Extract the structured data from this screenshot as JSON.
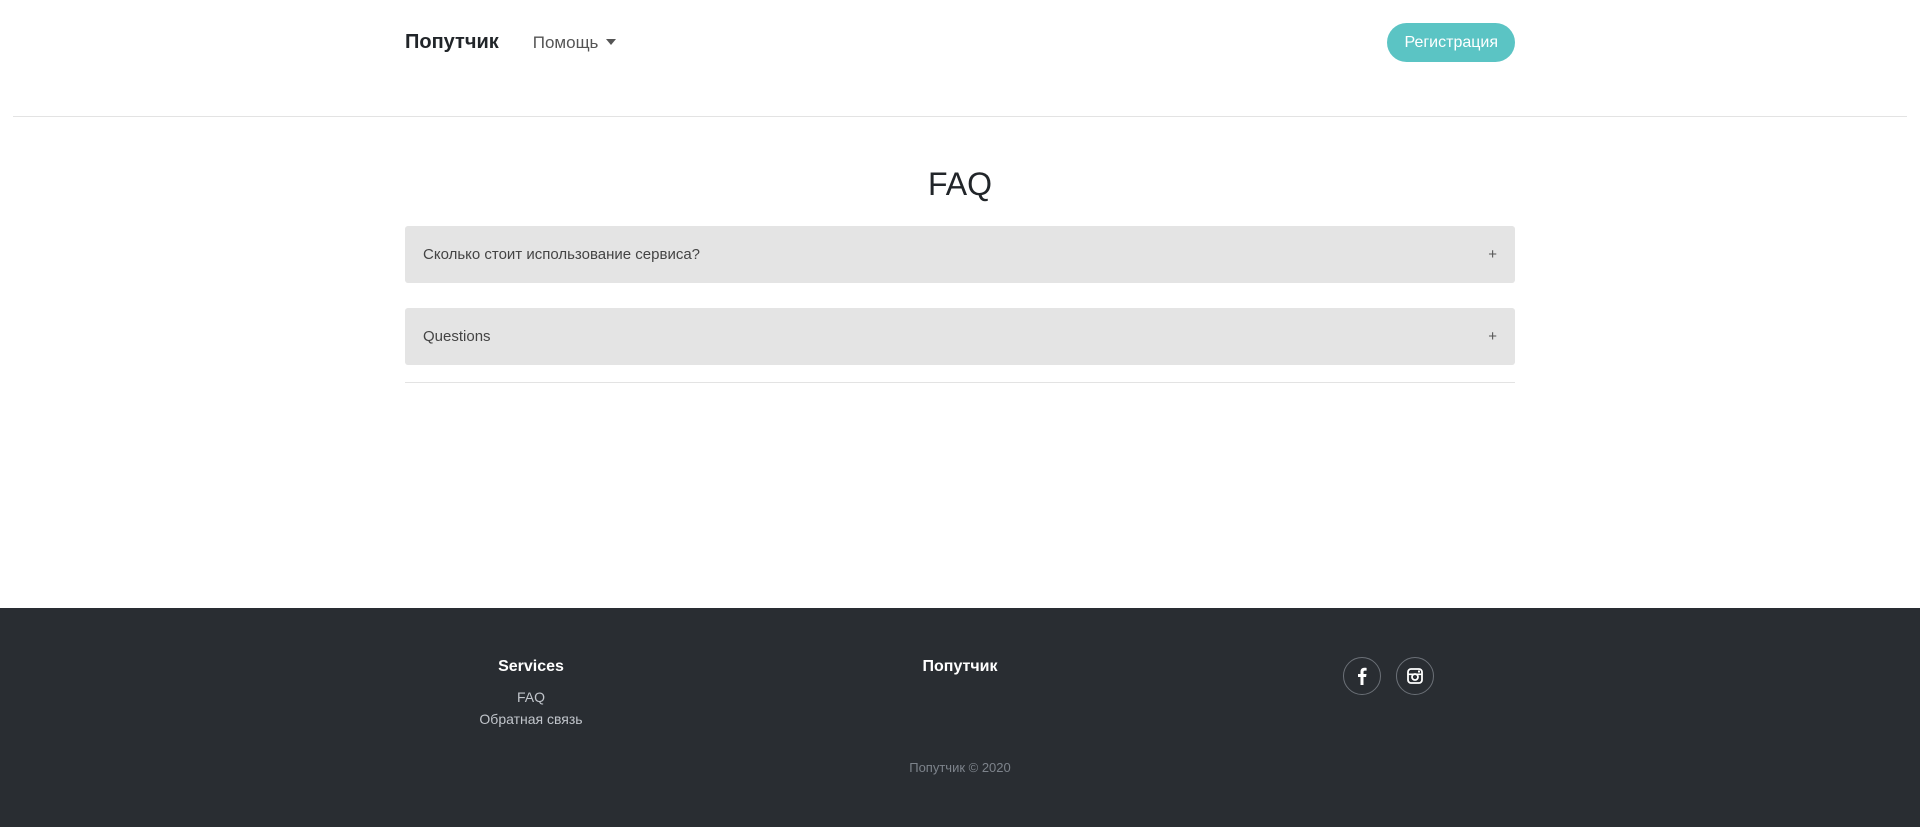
{
  "header": {
    "brand": "Попутчик",
    "help_label": "Помощь",
    "register_label": "Регистрация"
  },
  "main": {
    "title": "FAQ",
    "faq_items": [
      {
        "question": "Сколько стоит использование сервиса?",
        "toggle": "+"
      },
      {
        "question": "Questions",
        "toggle": "+"
      }
    ]
  },
  "footer": {
    "services": {
      "heading": "Services",
      "links": [
        "FAQ",
        "Обратная связь"
      ]
    },
    "brand_heading": "Попутчик",
    "social": [
      "facebook-icon",
      "instagram-icon"
    ],
    "copyright": "Попутчик © 2020"
  },
  "colors": {
    "accent": "#5bc4c4",
    "footer_bg": "#292d32",
    "faq_bg": "#e4e4e4"
  }
}
